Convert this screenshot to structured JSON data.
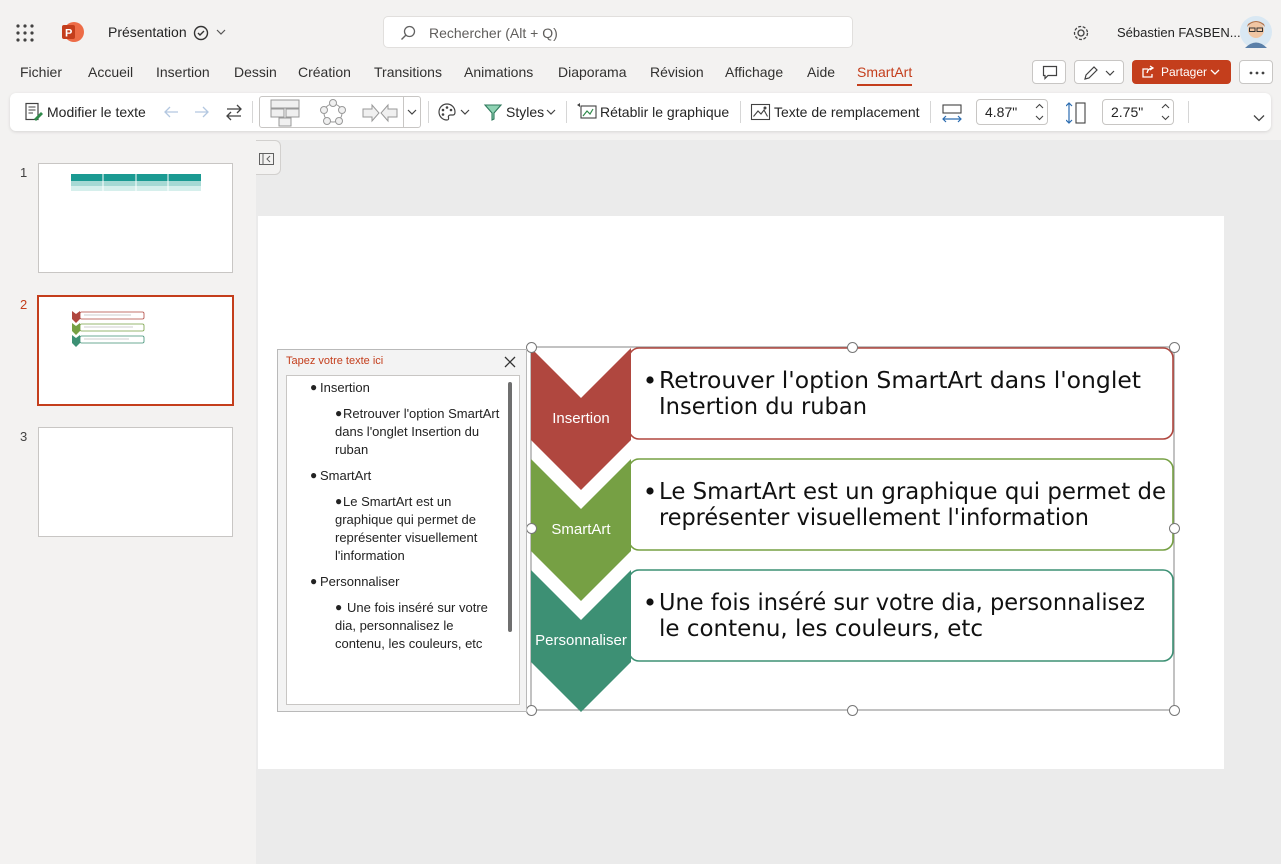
{
  "app": {
    "name": "PowerPoint",
    "file_title": "Présentation",
    "search_placeholder": "Rechercher (Alt + Q)",
    "user_name": "Sébastien FASBEN..."
  },
  "menu_tabs": [
    "Fichier",
    "Accueil",
    "Insertion",
    "Dessin",
    "Création",
    "Transitions",
    "Animations",
    "Diaporama",
    "Révision",
    "Affichage",
    "Aide",
    "SmartArt"
  ],
  "active_tab": "SmartArt",
  "share_label": "Partager",
  "ribbon": {
    "edit_text": "Modifier le texte",
    "styles": "Styles",
    "reset": "Rétablir le graphique",
    "alt_text": "Texte de remplacement",
    "width": "4.87\"",
    "height": "2.75\""
  },
  "slides": [
    "1",
    "2",
    "3"
  ],
  "text_pane": {
    "title": "Tapez votre texte ici",
    "items": [
      {
        "level": 1,
        "text": "Insertion"
      },
      {
        "level": 2,
        "text": "Retrouver l'option SmartArt dans l'onglet Insertion du ruban"
      },
      {
        "level": 1,
        "text": "SmartArt"
      },
      {
        "level": 2,
        "text": "Le SmartArt est un graphique qui permet de représenter visuellement l'information"
      },
      {
        "level": 1,
        "text": "Personnaliser"
      },
      {
        "level": 2,
        "text": "Une fois inséré sur votre dia, personnalisez le contenu, les couleurs, etc"
      }
    ]
  },
  "smartart": {
    "rows": [
      {
        "label": "Insertion",
        "text1": "Retrouver l'option SmartArt dans l'onglet",
        "text2": "Insertion du ruban",
        "color": "#b0473f"
      },
      {
        "label": "SmartArt",
        "text1": "Le SmartArt est un graphique qui permet de",
        "text2": "représenter visuellement l'information",
        "color": "#76a044"
      },
      {
        "label": "Personnaliser",
        "text1": " Une fois inséré sur votre dia, personnalisez",
        "text2": "le contenu, les couleurs, etc",
        "color": "#3d9074"
      }
    ]
  },
  "colors": {
    "accent": "#c43e1c"
  }
}
